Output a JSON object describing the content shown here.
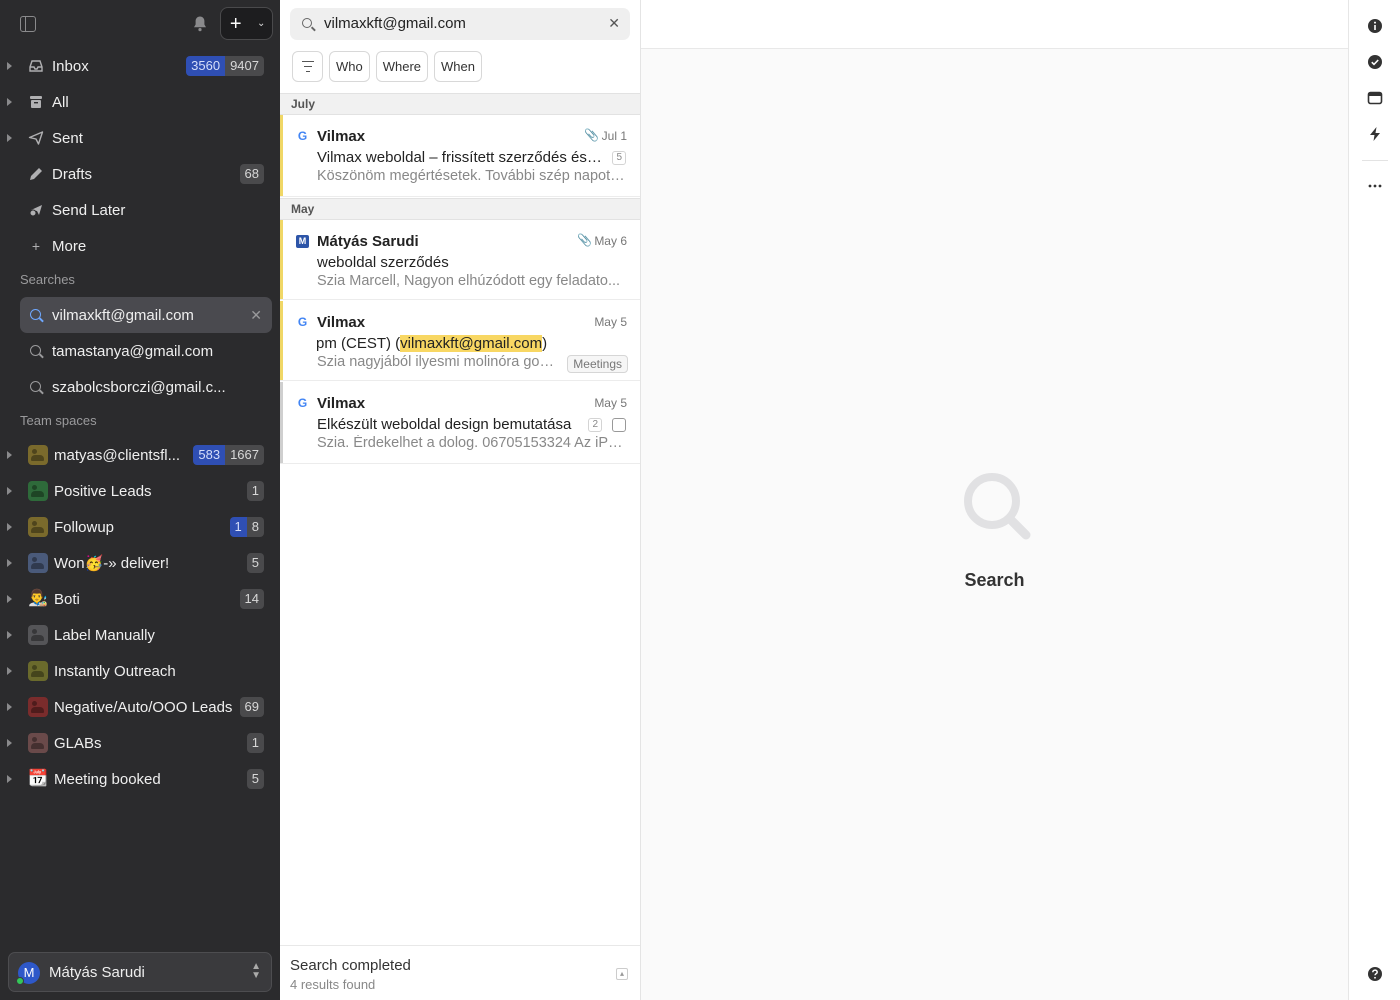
{
  "sidebar": {
    "nav": [
      {
        "label": "Inbox",
        "icon": "inbox-icon",
        "badge_blue": "3560",
        "badge_gray": "9407"
      },
      {
        "label": "All",
        "icon": "archive-icon"
      },
      {
        "label": "Sent",
        "icon": "send-icon"
      },
      {
        "label": "Drafts",
        "icon": "pencil-icon",
        "badge_gray": "68"
      },
      {
        "label": "Send Later",
        "icon": "clock-send-icon"
      },
      {
        "label": "More",
        "icon": "plus-icon"
      }
    ],
    "searches_heading": "Searches",
    "searches": [
      {
        "label": "vilmaxkft@gmail.com"
      },
      {
        "label": "tamastanya@gmail.com"
      },
      {
        "label": "szabolcsborczi@gmail.c..."
      }
    ],
    "team_heading": "Team spaces",
    "teams": [
      {
        "label": "matyas@clientsfl...",
        "color": "#7a6a2c",
        "badge_blue": "583",
        "badge_gray": "1667"
      },
      {
        "label": "Positive Leads",
        "color": "#2e6a3a",
        "badge_gray": "1"
      },
      {
        "label": "Followup",
        "color": "#7a6a2c",
        "badge_blue": "1",
        "badge_gray": "8"
      },
      {
        "label": "Won🥳-» deliver!",
        "color": "#4a5a7a",
        "badge_gray": "5"
      },
      {
        "label": "Boti",
        "emoji": "👨‍🎨",
        "badge_gray": "14"
      },
      {
        "label": "Label Manually",
        "color": "#555558"
      },
      {
        "label": "Instantly Outreach",
        "color": "#6a6a2c"
      },
      {
        "label": "Negative/Auto/OOO Leads",
        "color": "#7a2c2c",
        "badge_gray": "69"
      },
      {
        "label": "GLABs",
        "color": "#6a4a4a",
        "badge_gray": "1"
      },
      {
        "label": "Meeting booked",
        "emoji": "📆",
        "badge_gray": "5"
      }
    ],
    "account": {
      "initial": "M",
      "name": "Mátyás Sarudi"
    }
  },
  "search": {
    "query": "vilmaxkft@gmail.com",
    "filters": [
      "Who",
      "Where",
      "When"
    ]
  },
  "groups": [
    {
      "label": "July"
    },
    {
      "label": "May"
    }
  ],
  "emails": [
    {
      "source": "G",
      "sender": "Vilmax",
      "date": "Jul 1",
      "attachment": true,
      "subject": "Vilmax weboldal – frissített szerződés és s...",
      "count": "5",
      "preview": "Köszönöm megértésetek. További szép napot. ..."
    },
    {
      "source": "M",
      "sender": "Mátyás Sarudi",
      "date": "May 6",
      "attachment": true,
      "subject": "weboldal szerződés",
      "preview": "Szia Marcell, Nagyon elhúzódott egy feladato..."
    },
    {
      "source": "G",
      "sender": "Vilmax",
      "date": "May 5",
      "subject_pre": "pm (CEST) (",
      "subject_hl": "vilmaxkft@gmail.com",
      "subject_post": ")",
      "preview": "Szia nagyjából ilyesmi molinóra gon...",
      "tag": "Meetings"
    },
    {
      "source": "G",
      "sender": "Vilmax",
      "date": "May 5",
      "subject": "Elkészült weboldal design bemutatása",
      "count": "2",
      "preview": "Szia. Érdekelhet a dolog. 06705153324 Az iPh..."
    }
  ],
  "footer": {
    "status": "Search completed",
    "results": "4 results found"
  },
  "reading": {
    "empty_label": "Search"
  },
  "rail": {
    "icons": [
      "info-icon",
      "check-circle-icon",
      "window-icon",
      "bolt-icon",
      "more-icon",
      "help-icon"
    ]
  },
  "colors": {
    "sidebar_bg": "#2b2b2d",
    "accent_blue": "#2f4fb4",
    "highlight": "#f8d763"
  }
}
